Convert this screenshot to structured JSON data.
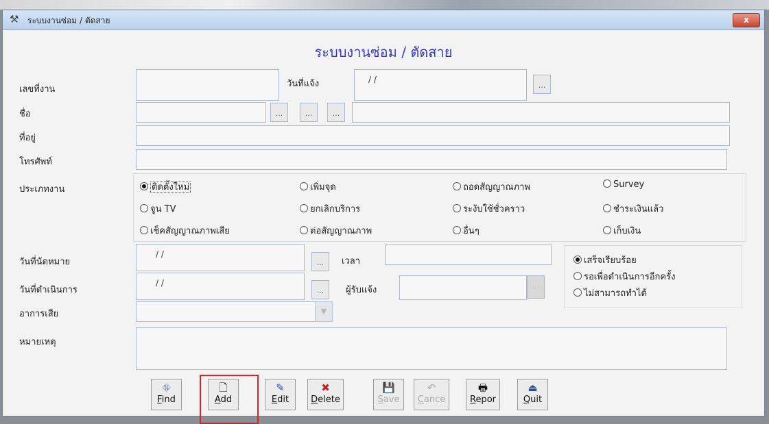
{
  "window": {
    "title": "ระบบงานซ่อม / ตัดสาย",
    "heading": "ระบบงานซ่อม / ตัดสาย",
    "close_label": "x"
  },
  "fields": {
    "job_no_label": "เลขที่งาน",
    "job_no_value": "",
    "notify_date_label": "วันที่แจ้ง",
    "notify_date_value": "/ /",
    "name_label": "ชื่อ",
    "address_label": "ที่อยู่",
    "phone_label": "โทรศัพท์",
    "job_type_label": "ประเภทงาน",
    "appointment_date_label": "วันที่นัดหมาย",
    "appointment_date_value": "/ /",
    "time_label": "เวลา",
    "operation_date_label": "วันที่ดำเนินการ",
    "operation_date_value": "/ /",
    "receiver_label": "ผู้รับแจ้ง",
    "symptom_label": "อาการเสีย",
    "note_label": "หมายเหตุ",
    "dots": "..."
  },
  "job_types": [
    {
      "label": "ติดตั้งใหม่",
      "selected": true
    },
    {
      "label": "เพิ่มจุด",
      "selected": false
    },
    {
      "label": "ถอดสัญญาณภาพ",
      "selected": false
    },
    {
      "label": "Survey",
      "selected": false
    },
    {
      "label": "จูน TV",
      "selected": false
    },
    {
      "label": "ยกเลิกบริการ",
      "selected": false
    },
    {
      "label": "ระงับใช้ชั่วคราว",
      "selected": false
    },
    {
      "label": "ชำระเงินแล้ว",
      "selected": false
    },
    {
      "label": "เช็คสัญญาณภาพเสีย",
      "selected": false
    },
    {
      "label": "ต่อสัญญาณภาพ",
      "selected": false
    },
    {
      "label": "อื่นๆ",
      "selected": false
    },
    {
      "label": "เก็บเงิน",
      "selected": false
    }
  ],
  "status": [
    {
      "label": "เสร็จเรียบร้อย",
      "selected": true
    },
    {
      "label": "รอเพื่อดำเนินการอีกครั้ง",
      "selected": false
    },
    {
      "label": "ไม่สามารถทำได้",
      "selected": false
    }
  ],
  "toolbar": {
    "find": {
      "key": "F",
      "rest": "ind"
    },
    "add": {
      "key": "A",
      "rest": "dd"
    },
    "edit": {
      "key": "E",
      "rest": "dit"
    },
    "delete": {
      "key": "D",
      "rest": "elete"
    },
    "save": {
      "key": "S",
      "rest": "ave"
    },
    "cancel": {
      "key": "C",
      "rest": "ance"
    },
    "report": {
      "key": "R",
      "rest": "epor"
    },
    "quit": {
      "key": "Q",
      "rest": "uit"
    }
  },
  "colors": {
    "heading": "#3a3ac0",
    "highlight": "#e02020"
  }
}
